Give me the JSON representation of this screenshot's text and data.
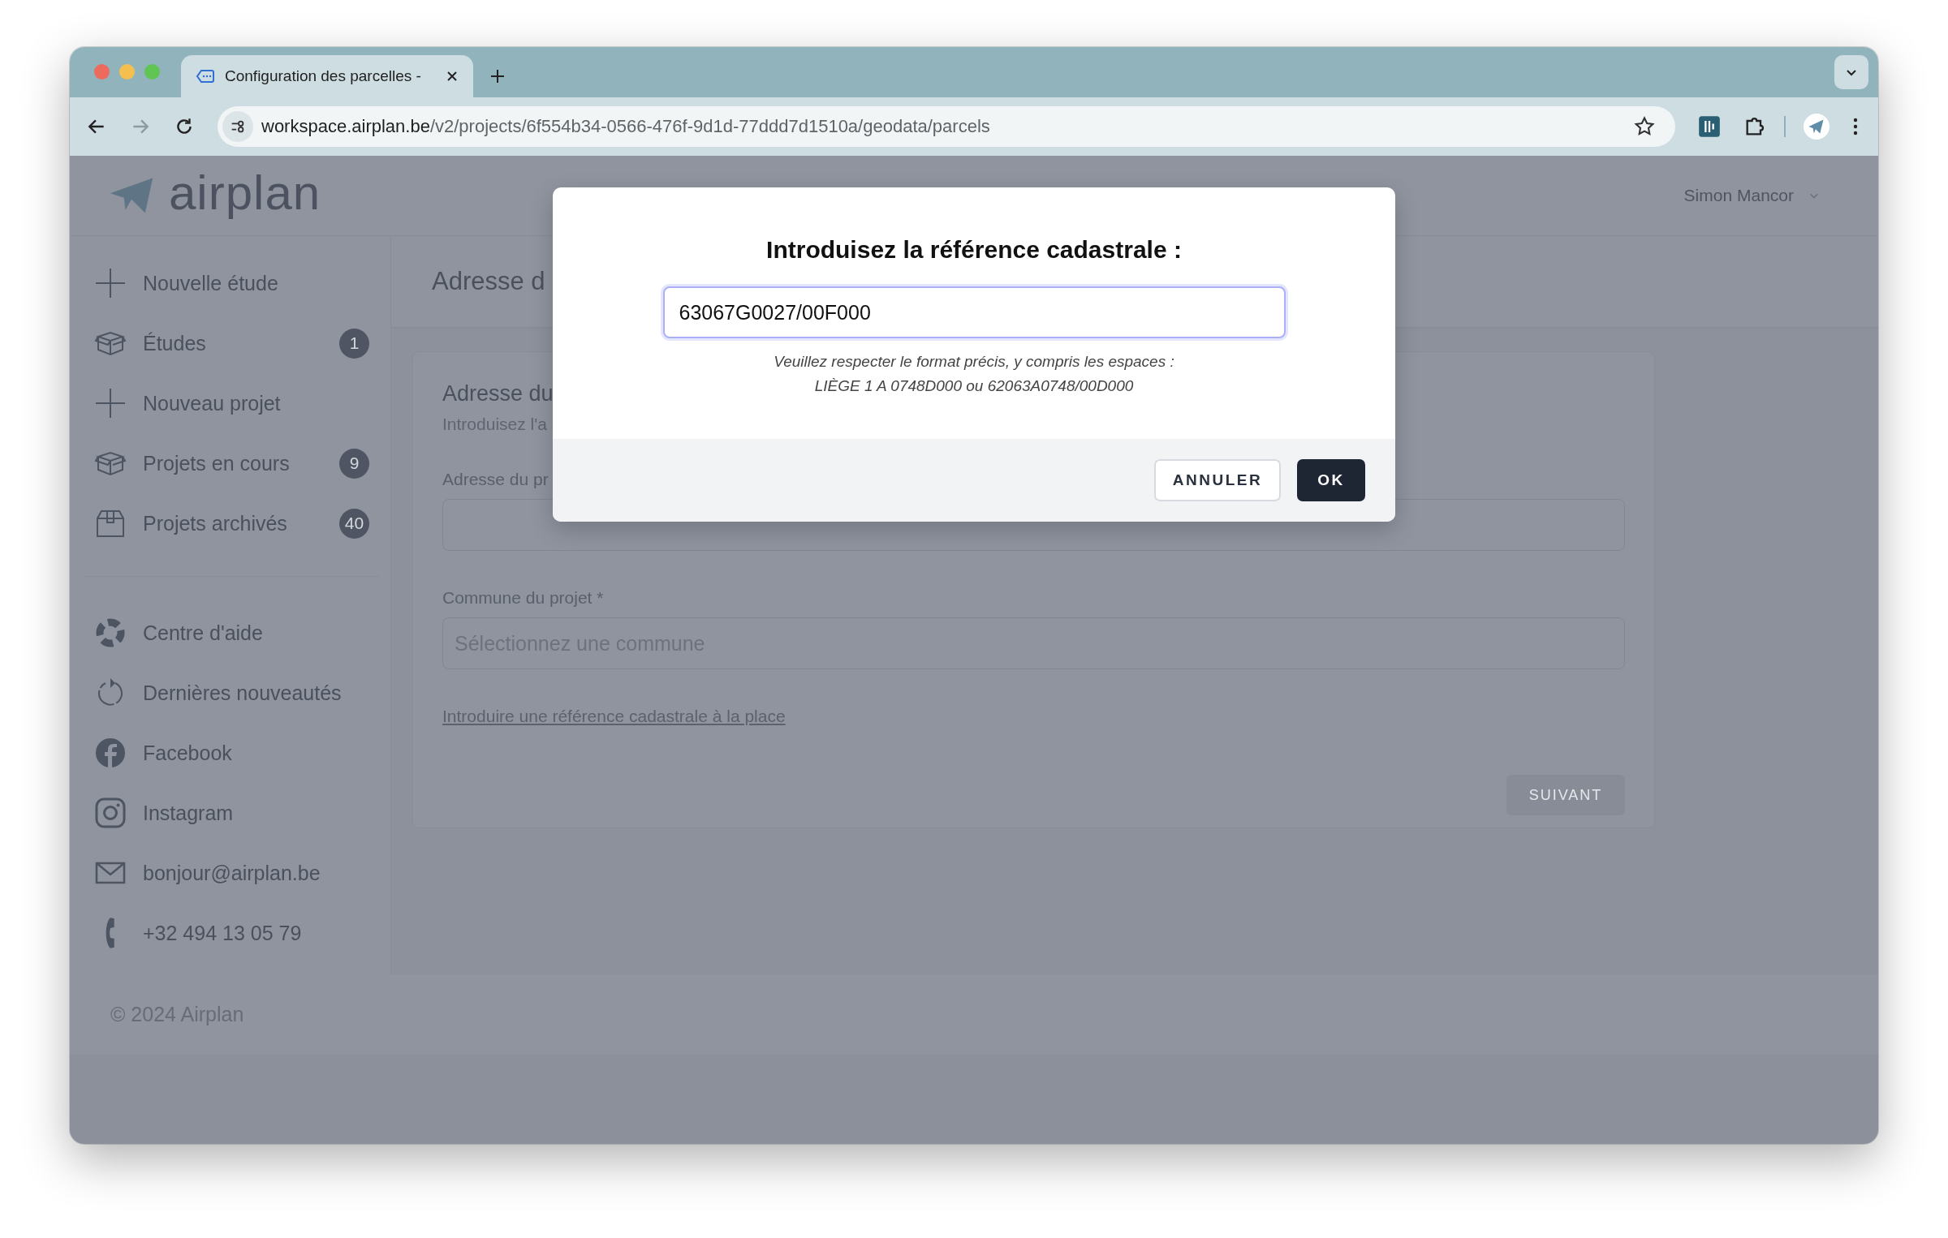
{
  "browser": {
    "tab": {
      "title": "Configuration des parcelles -"
    },
    "url": {
      "host": "workspace.airplan.be",
      "path": "/v2/projects/6f554b34-0566-476f-9d1d-77ddd7d1510a/geodata/parcels"
    }
  },
  "header": {
    "logo": "airplan",
    "user": "Simon Mancor"
  },
  "sidebar": {
    "items": [
      {
        "label": "Nouvelle étude",
        "kind": "plus"
      },
      {
        "label": "Études",
        "kind": "box",
        "badge": "1"
      },
      {
        "label": "Nouveau projet",
        "kind": "plus"
      },
      {
        "label": "Projets en cours",
        "kind": "box",
        "badge": "9"
      },
      {
        "label": "Projets archivés",
        "kind": "archive",
        "badge": "40"
      }
    ],
    "links": [
      {
        "label": "Centre d'aide",
        "kind": "help"
      },
      {
        "label": "Dernières nouveautés",
        "kind": "refresh"
      },
      {
        "label": "Facebook",
        "kind": "facebook"
      },
      {
        "label": "Instagram",
        "kind": "instagram"
      },
      {
        "label": "bonjour@airplan.be",
        "kind": "mail"
      },
      {
        "label": "+32 494 13 05 79",
        "kind": "phone"
      }
    ]
  },
  "page": {
    "title": "Adresse d",
    "card": {
      "title": "Adresse du",
      "subtitle": "Introduisez l'a",
      "fields": [
        {
          "label": "Adresse du pr"
        },
        {
          "label": "Commune du projet *",
          "placeholder": "Sélectionnez une commune"
        }
      ],
      "link": "Introduire une référence cadastrale à la place",
      "button": {
        "label": "SUIVANT",
        "disabled": true
      }
    }
  },
  "footer": "© 2024 Airplan",
  "dialog": {
    "title": "Introduisez la référence cadastrale :",
    "value": "63067G0027/00F000",
    "hint": [
      "Veuillez respecter le format précis, y compris les espaces :",
      "LIÈGE 1 A 0748D000 ou 62063A0748/00D000"
    ],
    "buttons": [
      {
        "label": "ANNULER",
        "kind": "secondary"
      },
      {
        "label": "OK",
        "kind": "primary"
      }
    ]
  }
}
